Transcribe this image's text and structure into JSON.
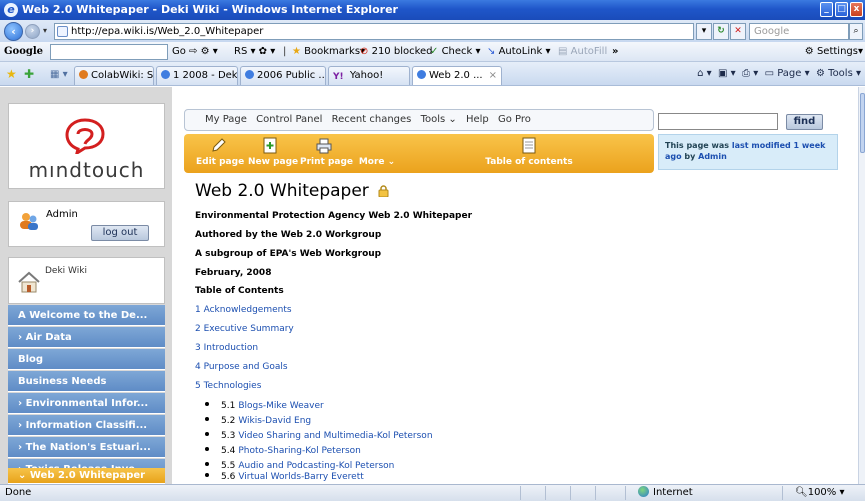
{
  "window": {
    "title": "Web 2.0 Whitepaper - Deki Wiki - Windows Internet Explorer",
    "controls": [
      "_",
      "□",
      "x"
    ]
  },
  "address_bar": {
    "url": "http://epa.wiki.is/Web_2.0_Whitepaper",
    "search_placeholder": "Google"
  },
  "google_toolbar": {
    "logo": "Google",
    "items": [
      "Go",
      "RS",
      "Bookmarks",
      "210 blocked",
      "Check",
      "AutoLink",
      "AutoFill",
      "Settings"
    ]
  },
  "tabs": [
    {
      "label": "ColabWiki: S..."
    },
    {
      "label": "1 2008 - Deki..."
    },
    {
      "label": "2006 Public ..."
    },
    {
      "label": "Yahoo!"
    },
    {
      "label": "Web 2.0 ..."
    }
  ],
  "tab_tools": [
    "Page",
    "Tools"
  ],
  "sidebar": {
    "logo_text": "mındtouch",
    "user": {
      "name": "Admin",
      "logout_label": "log out"
    },
    "nav_header": "Deki Wiki",
    "nav_items": [
      {
        "label": "A Welcome to the De...",
        "prefix": ""
      },
      {
        "label": "Air Data",
        "prefix": "›"
      },
      {
        "label": "Blog",
        "prefix": ""
      },
      {
        "label": "Business Needs",
        "prefix": ""
      },
      {
        "label": "Environmental Infor...",
        "prefix": "›"
      },
      {
        "label": "Information Classifi...",
        "prefix": "›"
      },
      {
        "label": "The Nation's Estuari...",
        "prefix": "›"
      },
      {
        "label": "Toxics Release Inve...",
        "prefix": "›"
      },
      {
        "label": "Web 2.0 Whitepaper",
        "prefix": "⌄"
      }
    ]
  },
  "main": {
    "top_nav": [
      "My Page",
      "Control Panel",
      "Recent changes",
      "Tools ⌄",
      "Help",
      "Go Pro"
    ],
    "find_label": "find",
    "toolbar": [
      "Edit page",
      "New page",
      "Print page",
      "More ⌄",
      "Table of contents"
    ],
    "notice": {
      "prefix": "This page was ",
      "link": "last modified 1 week ago",
      "by": " by ",
      "user": "Admin"
    },
    "title": "Web 2.0 Whitepaper",
    "lines": [
      "Environmental Protection Agency Web 2.0 Whitepaper",
      "Authored by the Web 2.0 Workgroup",
      "A subgroup of EPA's Web Workgroup",
      "February, 2008",
      "Table of Contents"
    ],
    "toc": [
      "1 Acknowledgements",
      "2 Executive Summary",
      "3 Introduction",
      "4 Purpose and Goals",
      "5 Technologies"
    ],
    "subtoc": [
      {
        "num": "5.1",
        "text": "Blogs-Mike Weaver"
      },
      {
        "num": "5.2",
        "text": "Wikis-David Eng"
      },
      {
        "num": "5.3",
        "text": "Video Sharing and Multimedia-Kol Peterson"
      },
      {
        "num": "5.4",
        "text": "Photo-Sharing-Kol Peterson"
      },
      {
        "num": "5.5",
        "text": "Audio and Podcasting-Kol Peterson"
      },
      {
        "num": "5.6",
        "text": "Virtual Worlds-Barry Everett"
      }
    ]
  },
  "statusbar": {
    "status": "Done",
    "zone": "Internet",
    "zoom": "100%"
  }
}
